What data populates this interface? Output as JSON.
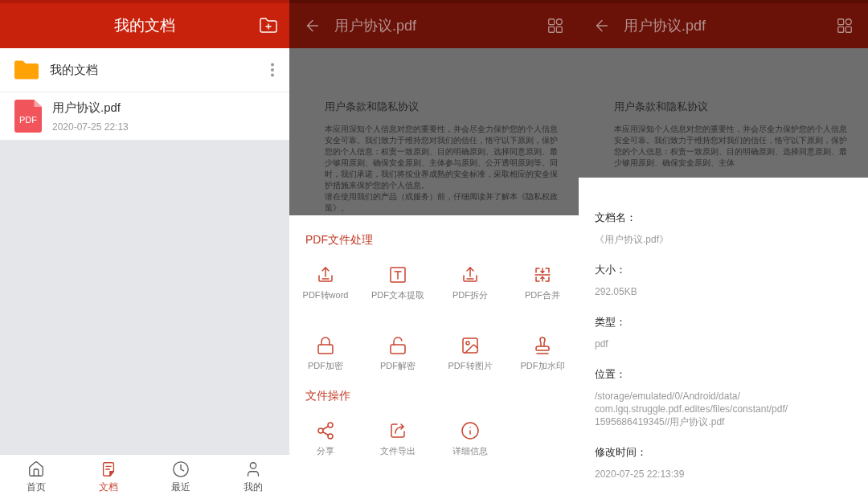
{
  "documents_screen": {
    "header": {
      "title": "我的文档"
    },
    "items": [
      {
        "kind": "folder",
        "name": "我的文档"
      },
      {
        "kind": "file",
        "name": "用户协议.pdf",
        "badge": "PDF",
        "modified": "2020-07-25 22:13"
      }
    ],
    "bottom_nav": [
      {
        "label": "首页",
        "selected": false
      },
      {
        "label": "文档",
        "selected": true
      },
      {
        "label": "最近",
        "selected": false
      },
      {
        "label": "我的",
        "selected": false
      }
    ]
  },
  "actions_screen": {
    "scrim": true,
    "header": {
      "title": "用户协议.pdf"
    },
    "document": {
      "title": "用户条款和隐私协议",
      "paragraphs": [
        "本应用深知个人信息对您的重要性，并会尽全力保护您的个人信息安全可靠。我们致力于维持您对我们的信任，恪守以下原则，保护您的个人信息：权责一致原则、目的明确原则、选择同意原则、最少够用原则、确保安全原则、主体参与原则、公开透明原则等。同时，我们承诺，我们将按业界成熟的安全标准，采取相应的安全保护措施来保护您的个人信息。",
        "请在使用我们的产品（或服务）前，仔细阅读并了解本《隐私权政策》。"
      ]
    },
    "sections": [
      {
        "title": "PDF文件处理",
        "actions": [
          {
            "label": "PDF转word"
          },
          {
            "label": "PDF文本提取"
          },
          {
            "label": "PDF拆分"
          },
          {
            "label": "PDF合并"
          },
          {
            "label": "PDF加密"
          },
          {
            "label": "PDF解密"
          },
          {
            "label": "PDF转图片"
          },
          {
            "label": "PDF加水印"
          }
        ]
      },
      {
        "title": "文件操作",
        "actions": [
          {
            "label": "分享"
          },
          {
            "label": "文件导出"
          },
          {
            "label": "详细信息"
          }
        ]
      }
    ]
  },
  "details_screen": {
    "scrim": true,
    "header": {
      "title": "用户协议.pdf"
    },
    "document": {
      "title": "用户条款和隐私协议",
      "paragraphs": [
        "本应用深知个人信息对您的重要性，并会尽全力保护您的个人信息安全可靠。我们致力于维持您对我们的信任，恪守以下原则，保护您的个人信息：权责一致原则、目的明确原则、选择同意原则、最少够用原则、确保安全原则、主体"
      ]
    },
    "details": [
      {
        "label": "文档名：",
        "lines": [
          "《用户协议.pdf》"
        ]
      },
      {
        "label": "大小：",
        "lines": [
          "292.05KB"
        ]
      },
      {
        "label": "类型：",
        "lines": [
          "pdf"
        ]
      },
      {
        "label": "位置：",
        "lines": [
          "/storage/emulated/0/Android/data/",
          "com.lgq.struggle.pdf.edites/files/constant/pdf/",
          "1595686419345//用户协议.pdf"
        ]
      },
      {
        "label": "修改时间：",
        "lines": [
          "2020-07-25 22:13:39"
        ]
      }
    ]
  }
}
